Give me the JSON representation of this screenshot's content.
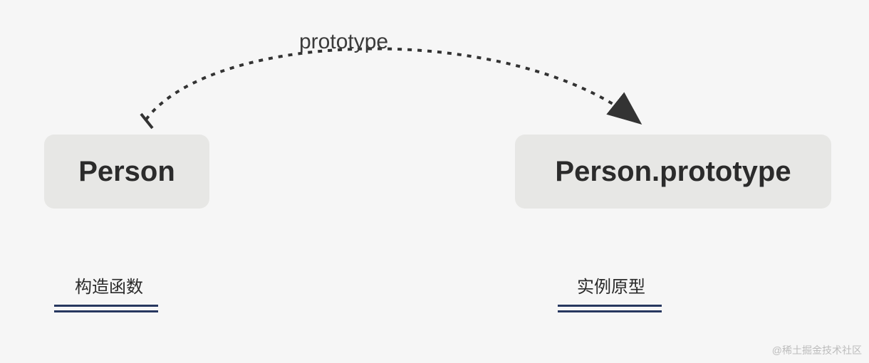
{
  "diagram": {
    "arrow_label": "prototype",
    "left_box": "Person",
    "right_box": "Person.prototype",
    "left_caption": "构造函数",
    "right_caption": "实例原型"
  },
  "watermark": "@稀土掘金技术社区"
}
